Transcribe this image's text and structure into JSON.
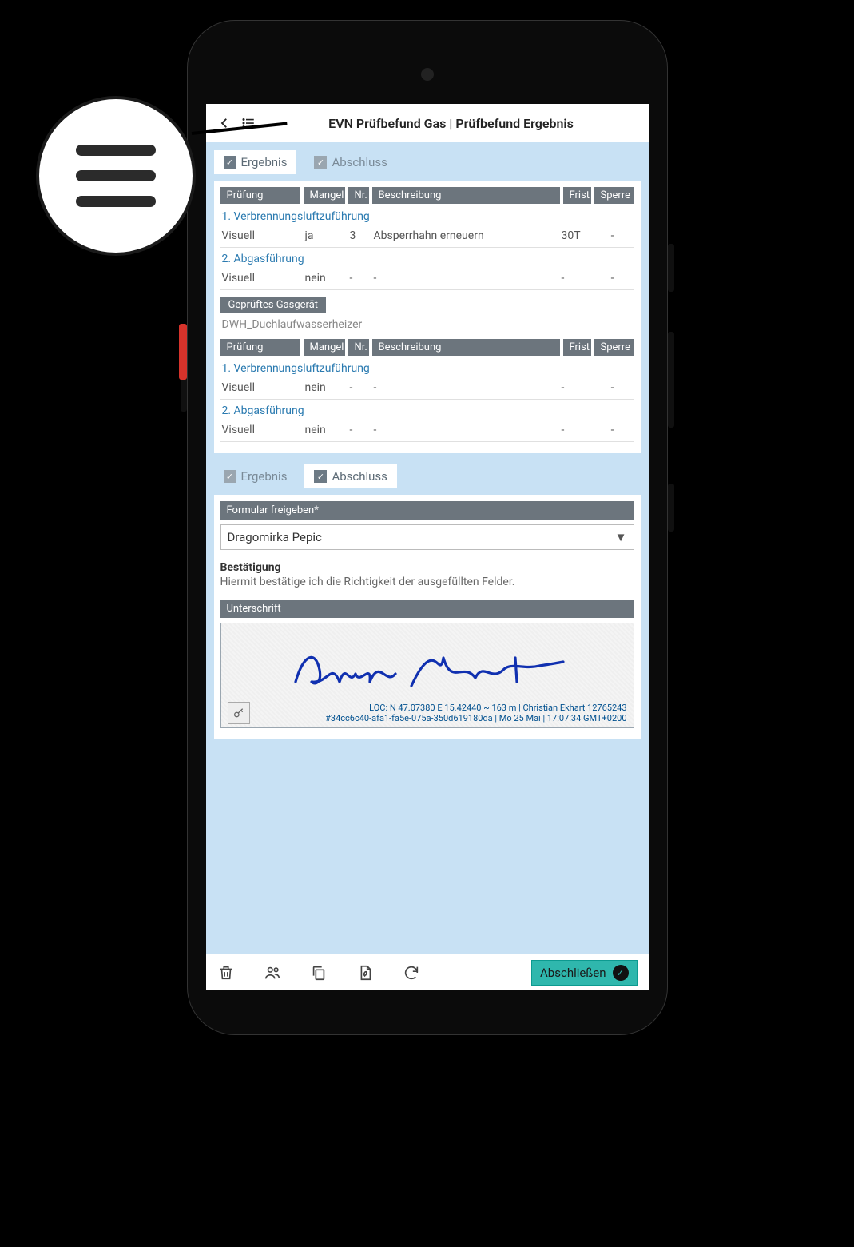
{
  "header": {
    "title": "EVN Prüfbefund Gas | Prüfbefund Ergebnis"
  },
  "tabs_top": {
    "ergebnis": "Ergebnis",
    "abschluss": "Abschluss"
  },
  "tabs_bottom": {
    "ergebnis": "Ergebnis",
    "abschluss": "Abschluss"
  },
  "table_headers": {
    "pruefung": "Prüfung",
    "mangel": "Mangel",
    "nr": "Nr.",
    "beschreibung": "Beschreibung",
    "frist": "Frist",
    "sperre": "Sperre"
  },
  "block1": {
    "sec1": "1. Verbrennungsluftzuführung",
    "row1": {
      "pruef": "Visuell",
      "mangel": "ja",
      "nr": "3",
      "beschr": "Absperrhahn erneuern",
      "frist": "30T",
      "sperre": "-"
    },
    "sec2": "2. Abgasführung",
    "row2": {
      "pruef": "Visuell",
      "mangel": "nein",
      "nr": "-",
      "beschr": "-",
      "frist": "-",
      "sperre": "-"
    }
  },
  "device": {
    "label": "Geprüftes Gasgerät",
    "value": "DWH_Duchlaufwasserheizer"
  },
  "block2": {
    "sec1": "1. Verbrennungsluftzuführung",
    "row1": {
      "pruef": "Visuell",
      "mangel": "nein",
      "nr": "-",
      "beschr": "-",
      "frist": "-",
      "sperre": "-"
    },
    "sec2": "2. Abgasführung",
    "row2": {
      "pruef": "Visuell",
      "mangel": "nein",
      "nr": "-",
      "beschr": "-",
      "frist": "-",
      "sperre": "-"
    }
  },
  "release": {
    "label": "Formular freigeben*",
    "selected": "Dragomirka Pepic"
  },
  "confirm": {
    "title": "Bestätigung",
    "text": "Hiermit bestätige ich die Richtigkeit der ausgefüllten Felder."
  },
  "signature": {
    "label": "Unterschrift",
    "meta_line1": "LOC: N 47.07380  E 15.42440  ~ 163 m | Christian Ekhart 12765243",
    "meta_line2": "#34cc6c40-afa1-fa5e-075a-350d619180da | Mo 25 Mai | 17:07:34 GMT+0200"
  },
  "actions": {
    "abschliessen": "Abschließen"
  }
}
